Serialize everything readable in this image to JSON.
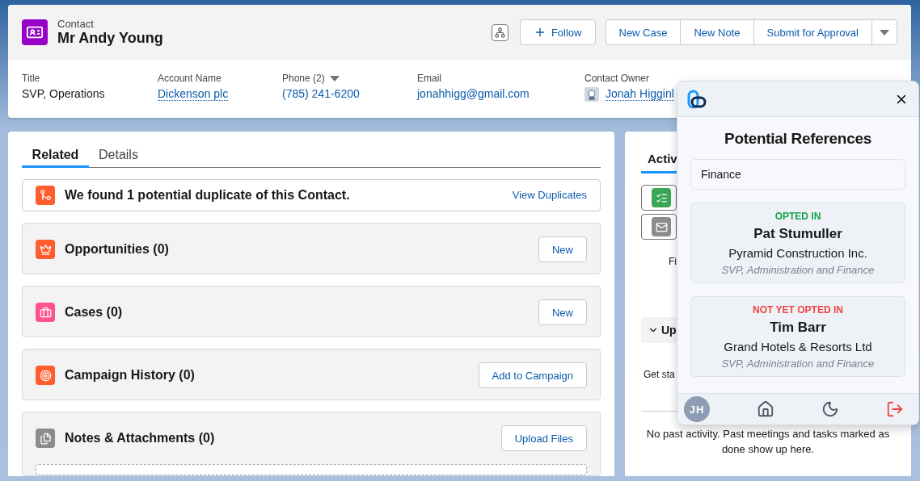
{
  "record": {
    "object_label": "Contact",
    "name": "Mr Andy Young"
  },
  "actions": {
    "follow": "Follow",
    "buttons": [
      "New Case",
      "New Note",
      "Submit for Approval"
    ]
  },
  "fields": [
    {
      "label": "Title",
      "value": "SVP, Operations",
      "kind": "text"
    },
    {
      "label": "Account Name",
      "value": "Dickenson plc",
      "kind": "link"
    },
    {
      "label": "Phone (2)",
      "value": "(785) 241-6200",
      "kind": "phone"
    },
    {
      "label": "Email",
      "value": "jonahhigg@gmail.com",
      "kind": "email"
    },
    {
      "label": "Contact Owner",
      "value": "Jonah Higginl",
      "kind": "owner"
    }
  ],
  "tabs": [
    {
      "label": "Related",
      "selected": true
    },
    {
      "label": "Details",
      "selected": false
    }
  ],
  "duplicate_alert": {
    "message": "We found 1 potential duplicate of this Contact.",
    "link": "View Duplicates"
  },
  "related_lists": [
    {
      "title": "Opportunities (0)",
      "button": "New",
      "kind": "opportunity"
    },
    {
      "title": "Cases (0)",
      "button": "New",
      "kind": "case"
    },
    {
      "title": "Campaign History (0)",
      "button": "Add to Campaign",
      "kind": "campaign"
    },
    {
      "title": "Notes & Attachments (0)",
      "button": "Upload Files",
      "kind": "notes"
    }
  ],
  "activity": {
    "tab": "Activ",
    "filter_text": "Fi",
    "section": "Up",
    "upcoming_text": "Get sta",
    "past_text": "No past activity. Past meetings and tasks marked as done show up here."
  },
  "popup": {
    "title": "Potential References",
    "search": "Finance",
    "references": [
      {
        "status": "OPTED IN",
        "opted_in": true,
        "name": "Pat Stumuller",
        "company": "Pyramid Construction Inc.",
        "title": "SVP, Administration and Finance"
      },
      {
        "status": "NOT YET OPTED IN",
        "opted_in": false,
        "name": "Tim Barr",
        "company": "Grand Hotels & Resorts Ltd",
        "title": "SVP, Administration and Finance"
      }
    ],
    "avatar": "JH"
  }
}
